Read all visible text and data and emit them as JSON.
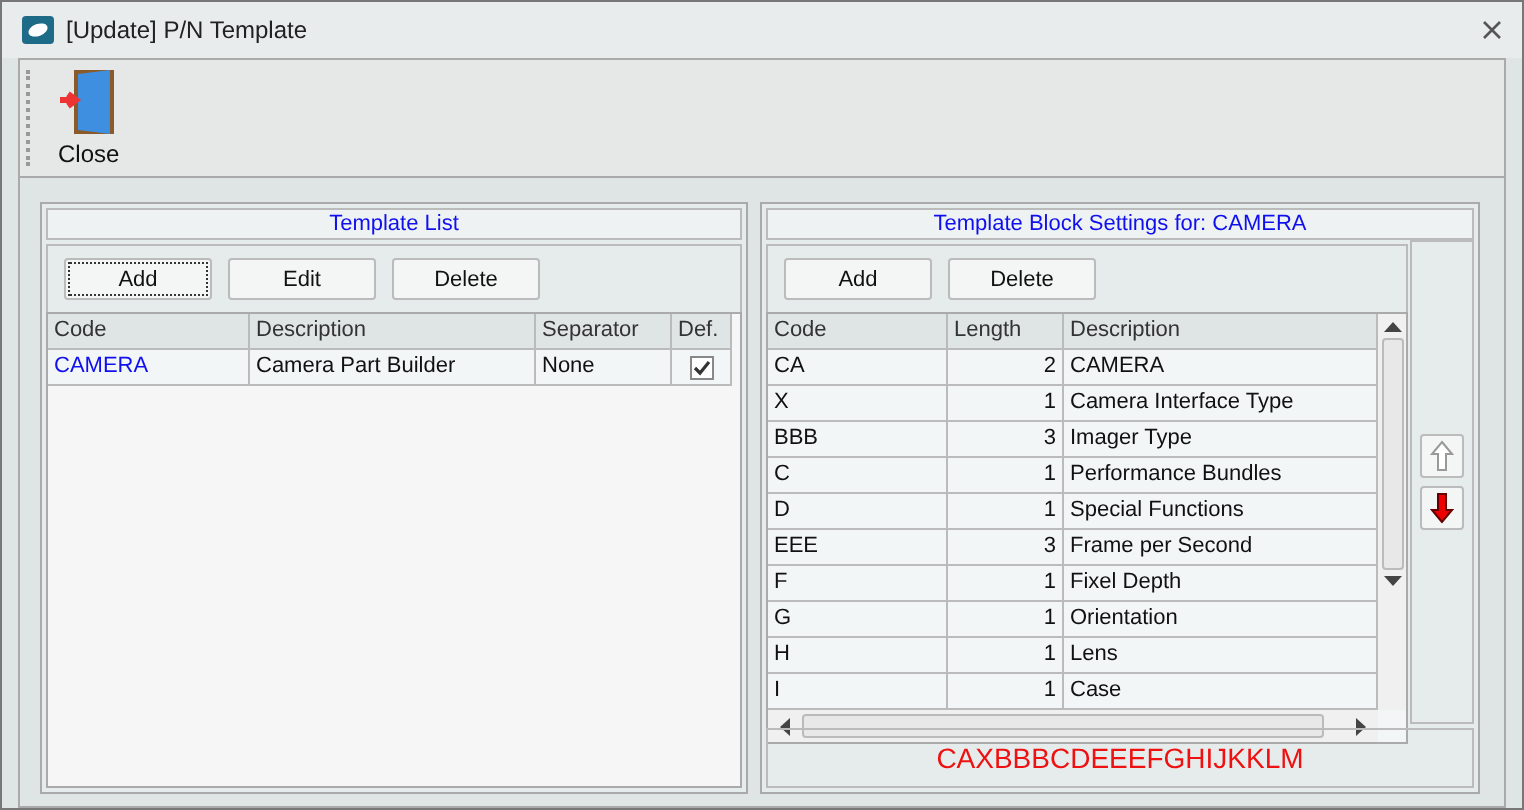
{
  "window": {
    "title": "[Update] P/N Template"
  },
  "toolbar": [
    {
      "label": "Close"
    }
  ],
  "template_list": {
    "title": "Template List",
    "buttons": [
      {
        "label": "Add",
        "focused": true
      },
      {
        "label": "Edit",
        "focused": false
      },
      {
        "label": "Delete",
        "focused": false
      }
    ],
    "columns": [
      "Code",
      "Description",
      "Separator",
      "Def."
    ],
    "rows": [
      {
        "code": "CAMERA",
        "description": "Camera Part Builder",
        "separator": "None",
        "default": true
      }
    ]
  },
  "block_settings": {
    "title": "Template Block Settings for: CAMERA",
    "buttons": [
      {
        "label": "Add"
      },
      {
        "label": "Delete"
      }
    ],
    "columns": [
      "Code",
      "Length",
      "Description"
    ],
    "rows": [
      {
        "code": "CA",
        "length": "2",
        "description": "CAMERA"
      },
      {
        "code": "X",
        "length": "1",
        "description": "Camera Interface Type"
      },
      {
        "code": "BBB",
        "length": "3",
        "description": "Imager Type"
      },
      {
        "code": "C",
        "length": "1",
        "description": "Performance Bundles"
      },
      {
        "code": "D",
        "length": "1",
        "description": "Special Functions"
      },
      {
        "code": "EEE",
        "length": "3",
        "description": "Frame per Second"
      },
      {
        "code": "F",
        "length": "1",
        "description": "Fixel Depth"
      },
      {
        "code": "G",
        "length": "1",
        "description": "Orientation"
      },
      {
        "code": "H",
        "length": "1",
        "description": "Lens"
      },
      {
        "code": "I",
        "length": "1",
        "description": "Case"
      }
    ],
    "move_buttons": [
      {
        "kind": "up",
        "disabled": true
      },
      {
        "kind": "down",
        "disabled": false
      }
    ],
    "preview": "CAXBBBCDEEEFGHIJKKLM"
  }
}
